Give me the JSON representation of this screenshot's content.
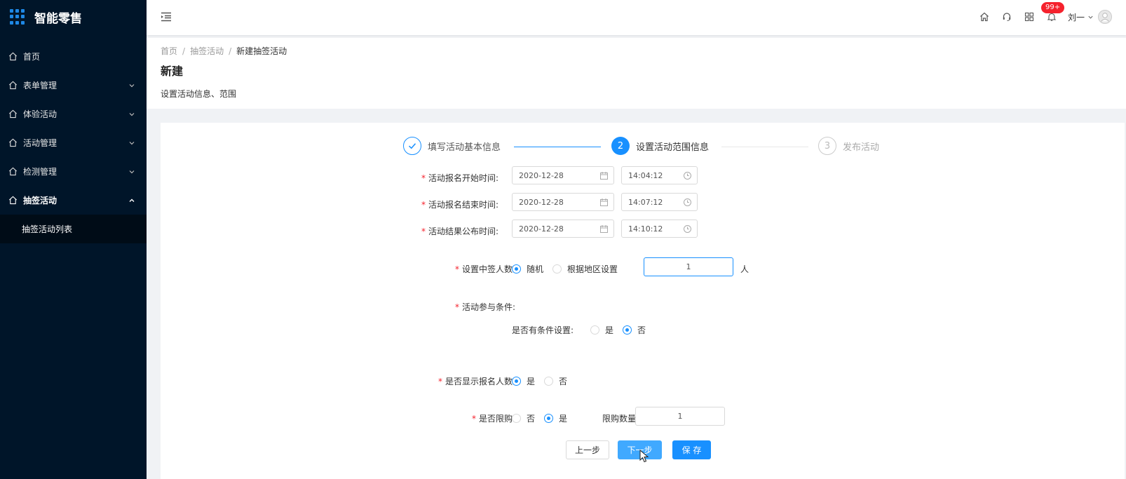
{
  "app": {
    "title": "智能零售"
  },
  "sidebar": {
    "items": [
      {
        "label": "首页",
        "has_children": false
      },
      {
        "label": "表单管理",
        "has_children": true
      },
      {
        "label": "体验活动",
        "has_children": true
      },
      {
        "label": "活动管理",
        "has_children": true
      },
      {
        "label": "检测管理",
        "has_children": true
      },
      {
        "label": "抽签活动",
        "has_children": true,
        "open": true
      }
    ],
    "submenu": [
      {
        "label": "抽签活动列表"
      }
    ]
  },
  "header": {
    "notification_badge": "99+",
    "user_name": "刘一",
    "icons": [
      "home-icon",
      "headset-icon",
      "grid-icon",
      "bell-icon"
    ]
  },
  "breadcrumb": {
    "items": [
      "首页",
      "抽签活动",
      "新建抽签活动"
    ]
  },
  "page": {
    "title": "新建",
    "description": "设置活动信息、范围"
  },
  "steps": [
    {
      "number": "1",
      "label": "填写活动基本信息",
      "status": "done"
    },
    {
      "number": "2",
      "label": "设置活动范围信息",
      "status": "active"
    },
    {
      "number": "3",
      "label": "发布活动",
      "status": "pending"
    }
  ],
  "form": {
    "signup_start": {
      "label": "活动报名开始时间:",
      "date": "2020-12-28",
      "time": "14:04:12"
    },
    "signup_end": {
      "label": "活动报名结束时间:",
      "date": "2020-12-28",
      "time": "14:07:12"
    },
    "result_publish": {
      "label": "活动结果公布时间:",
      "date": "2020-12-28",
      "time": "14:10:12"
    },
    "winners": {
      "label": "设置中签人数:",
      "options": [
        "随机",
        "根据地区设置"
      ],
      "selected": "随机",
      "count": "1",
      "unit": "人"
    },
    "conditions": {
      "label": "活动参与条件:",
      "sub_label": "是否有条件设置:",
      "options": [
        "是",
        "否"
      ],
      "selected": "否"
    },
    "show_count": {
      "label": "是否显示报名人数:",
      "options": [
        "是",
        "否"
      ],
      "selected": "是"
    },
    "limit": {
      "label": "是否限购:",
      "options": [
        "否",
        "是"
      ],
      "selected": "是",
      "qty_label": "限购数量:",
      "qty": "1"
    }
  },
  "buttons": {
    "prev": "上一步",
    "next": "下一步",
    "save": "保 存"
  },
  "colors": {
    "sidebar_bg": "#001529",
    "primary": "#1890ff",
    "required": "#f5222d"
  }
}
